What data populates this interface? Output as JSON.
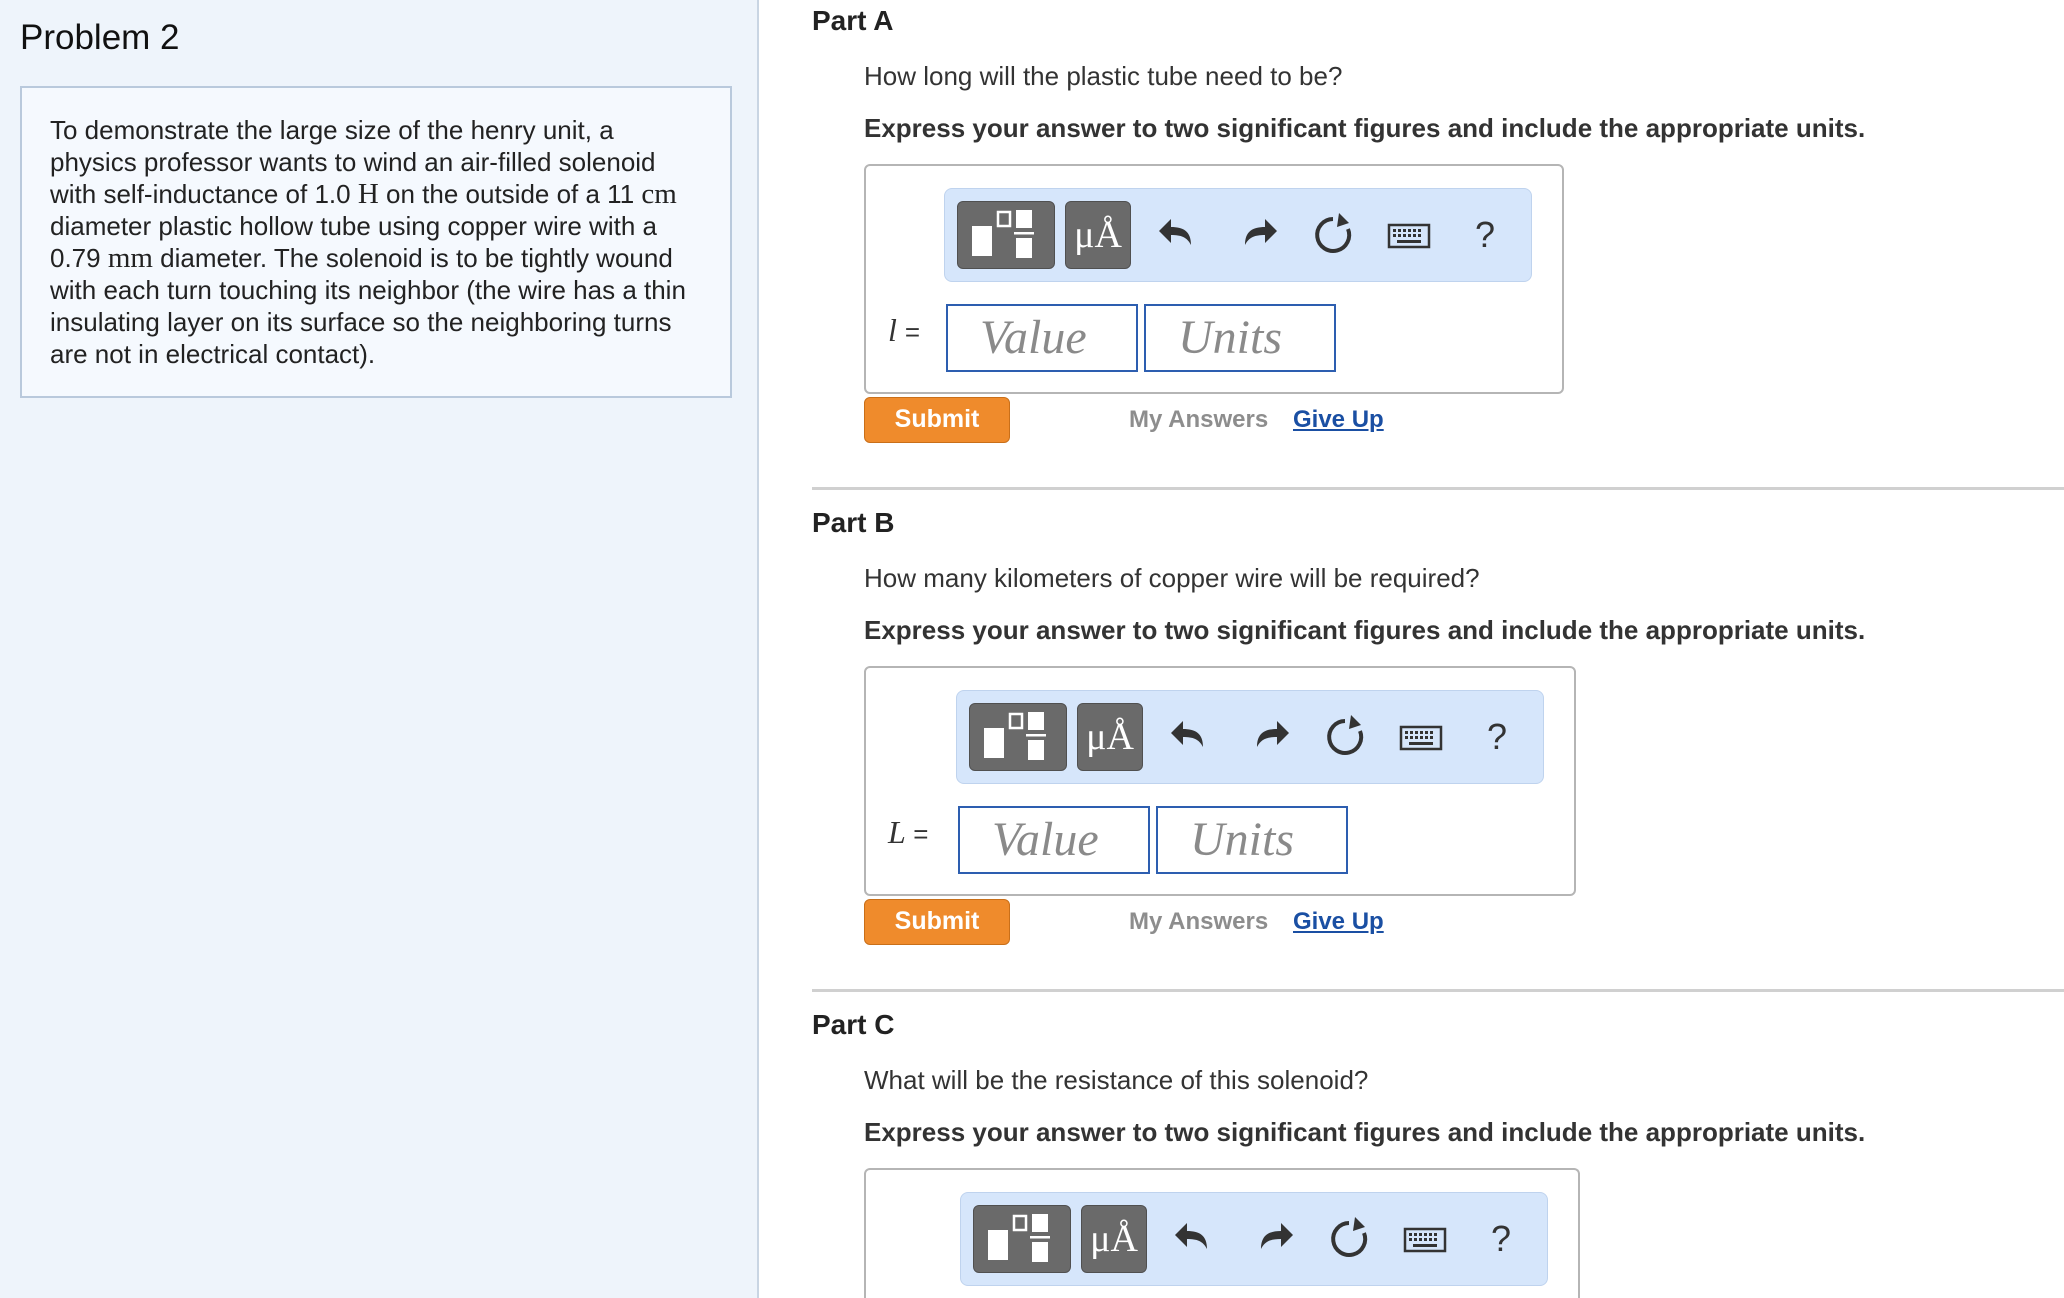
{
  "problem": {
    "title": "Problem 2",
    "text_parts": [
      "To demonstrate the large size of the henry unit, a physics professor wants to wind an air-filled solenoid with self-inductance of 1.0 ",
      "H",
      " on the outside of a 11 ",
      "cm",
      " diameter plastic hollow tube using copper wire with a 0.79 ",
      "mm",
      " diameter. The solenoid is to be tightly wound with each turn touching its neighbor (the wire has a thin insulating layer on its surface so the neighboring turns are not in electrical contact)."
    ]
  },
  "toolbar": {
    "mu_label": "μÅ",
    "help_label": "?"
  },
  "placeholders": {
    "value": "Value",
    "units": "Units"
  },
  "actions": {
    "submit": "Submit",
    "my_answers": "My Answers",
    "give_up": "Give Up"
  },
  "parts": [
    {
      "title": "Part A",
      "question": "How long will the plastic tube need to be?",
      "instruction": "Express your answer to two significant figures and include the appropriate units.",
      "variable": "l",
      "equals": "="
    },
    {
      "title": "Part B",
      "question": "How many kilometers of copper wire will be required?",
      "instruction": "Express your answer to two significant figures and include the appropriate units.",
      "variable": "L",
      "equals": "="
    },
    {
      "title": "Part C",
      "question": "What will be the resistance of this solenoid?",
      "instruction": "Express your answer to two significant figures and include the appropriate units."
    }
  ]
}
